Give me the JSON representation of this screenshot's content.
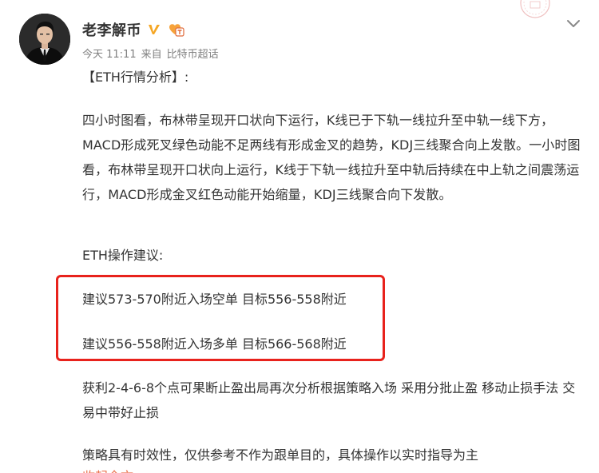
{
  "author": {
    "name": "老李解币",
    "verified_icon": "verified-v-icon",
    "badge_icon": "member-badge-icon"
  },
  "meta": {
    "time": "今天 11:11",
    "source_prefix": "来自",
    "source": "比特币超话"
  },
  "post": {
    "heading": "【ETH行情分析】:",
    "analysis": "四小时图看，布林带呈现开口状向下运行，K线已于下轨一线拉升至中轨一线下方，MACD形成死叉绿色动能不足两线有形成金叉的趋势，KDJ三线聚合向上发散。一小时图看，布林带呈现开口状向上运行，K线于下轨一线拉升至中轨后持续在中上轨之间震荡运行，MACD形成金叉红色动能开始缩量，KDJ三线聚合向下发散。",
    "advice_title": "ETH操作建议:",
    "advice_1": "建议573-570附近入场空单 目标556-558附近",
    "advice_2": "建议556-558附近入场多单 目标566-568附近",
    "profit_note": "获利2-4-6-8个点可果断止盈出局再次分析根据策略入场 采用分批止盈 移动止损手法 交易中带好止损",
    "disclaimer": "策略具有时效性，仅供参考不作为跟单目的，具体操作以实时指导为主",
    "cutoff_text": "收起全文"
  },
  "colors": {
    "highlight_border": "#e8221c",
    "verified": "#f5a623",
    "link": "#eb7350",
    "meta_text": "#808080"
  }
}
